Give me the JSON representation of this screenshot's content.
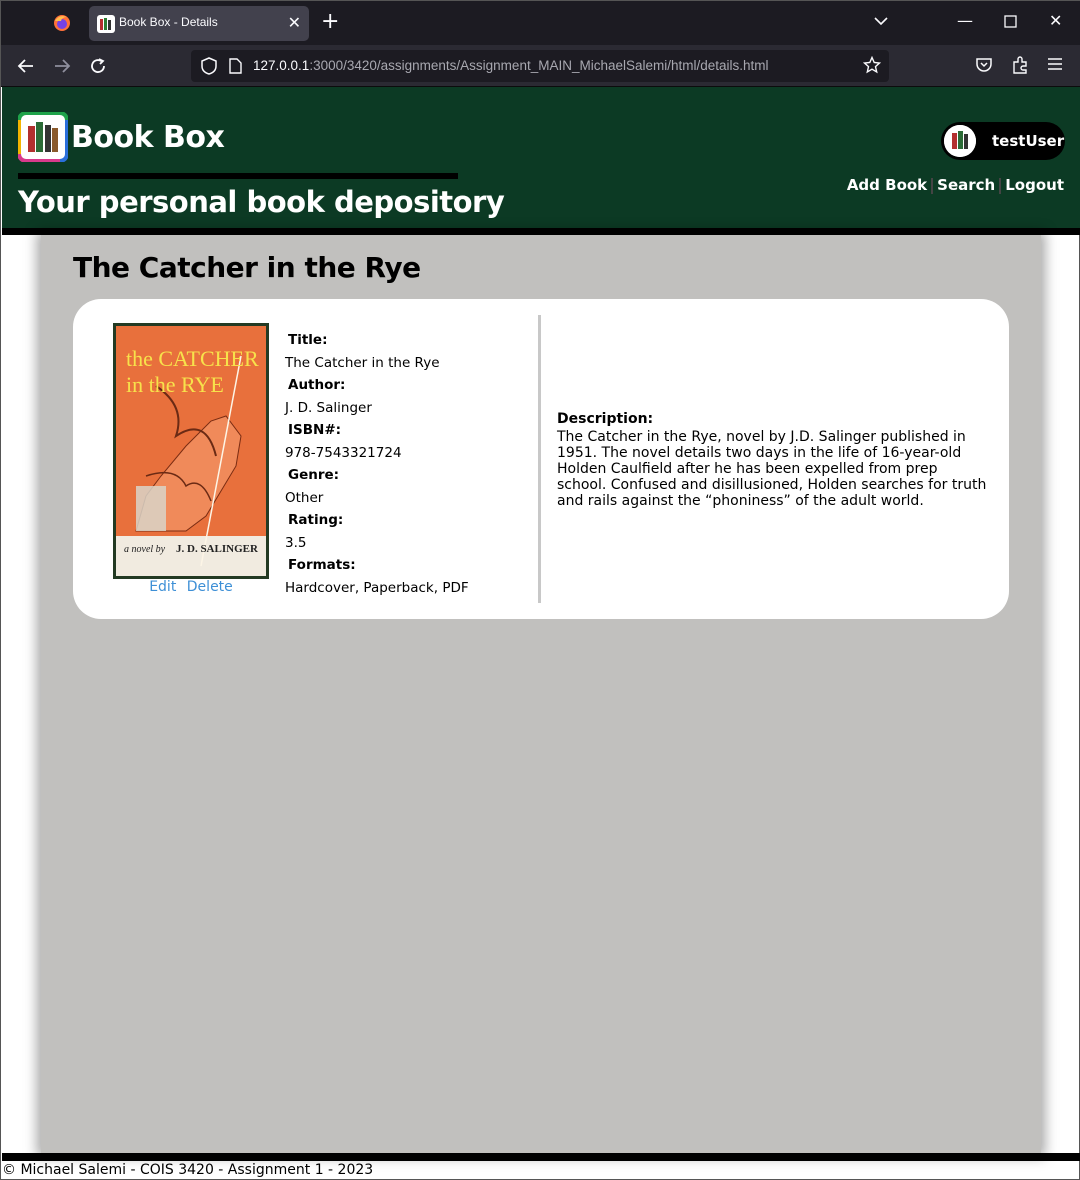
{
  "browser": {
    "tab_title": "Book Box - Details",
    "url_host": "127.0.0.1",
    "url_rest": ":3000/3420/assignments/Assignment_MAIN_MichaelSalemi/html/details.html"
  },
  "header": {
    "brand": "Book Box",
    "tagline": "Your personal book depository",
    "username": "testUser",
    "nav": {
      "add_book": "Add Book",
      "search": "Search",
      "logout": "Logout"
    }
  },
  "book": {
    "heading": "The Catcher in the Rye",
    "cover_text": {
      "line1": "the CATCHER",
      "line2": "in the RYE",
      "byline": "a novel by",
      "author": "J. D. SALINGER"
    },
    "actions": {
      "edit": "Edit",
      "delete": "Delete"
    },
    "fields": [
      {
        "label": "Title:",
        "value": "The Catcher in the Rye"
      },
      {
        "label": "Author:",
        "value": "J. D. Salinger"
      },
      {
        "label": "ISBN#:",
        "value": "978-7543321724"
      },
      {
        "label": "Genre:",
        "value": "Other"
      },
      {
        "label": "Rating:",
        "value": "3.5"
      },
      {
        "label": "Formats:",
        "value": "Hardcover, Paperback, PDF"
      }
    ],
    "description_label": "Description:",
    "description": "The Catcher in the Rye, novel by J.D. Salinger published in 1951. The novel details two days in the life of 16-year-old Holden Caulfield after he has been expelled from prep school. Confused and disillusioned, Holden searches for truth and rails against the “phoniness” of the adult world."
  },
  "footer": {
    "text": "© Michael Salemi - COIS 3420 - Assignment 1 - 2023"
  },
  "colors": {
    "header_bg": "#0c3a24",
    "main_bg": "#c1c0be",
    "link": "#3d8fd6"
  }
}
